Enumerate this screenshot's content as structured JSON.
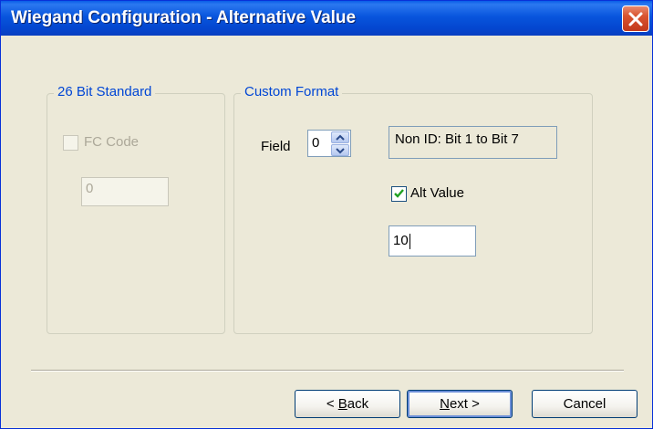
{
  "window": {
    "title": "Wiegand Configuration - Alternative Value"
  },
  "standard_group": {
    "legend": "26 Bit Standard",
    "fc_code_label": "FC Code",
    "fc_code_checked": false,
    "fc_code_value": "0",
    "enabled": false
  },
  "custom_group": {
    "legend": "Custom Format",
    "field_label": "Field",
    "field_value": "0",
    "field_description": "Non ID: Bit 1 to Bit 7",
    "alt_value_label": "Alt Value",
    "alt_value_checked": true,
    "alt_value_input": "10"
  },
  "buttons": {
    "back": {
      "prefix": "< ",
      "accel": "B",
      "rest": "ack"
    },
    "next": {
      "accel": "N",
      "rest": "ext",
      "suffix": " >"
    },
    "cancel": "Cancel"
  },
  "icons": {
    "close": "close-icon",
    "spin_up": "arrow-up-icon",
    "spin_down": "arrow-down-icon",
    "check": "checkmark-icon"
  },
  "colors": {
    "titlebar": "#0855dd",
    "group_legend": "#0046d5",
    "dialog_background": "#ece9d8",
    "checkmark": "#21a121"
  }
}
